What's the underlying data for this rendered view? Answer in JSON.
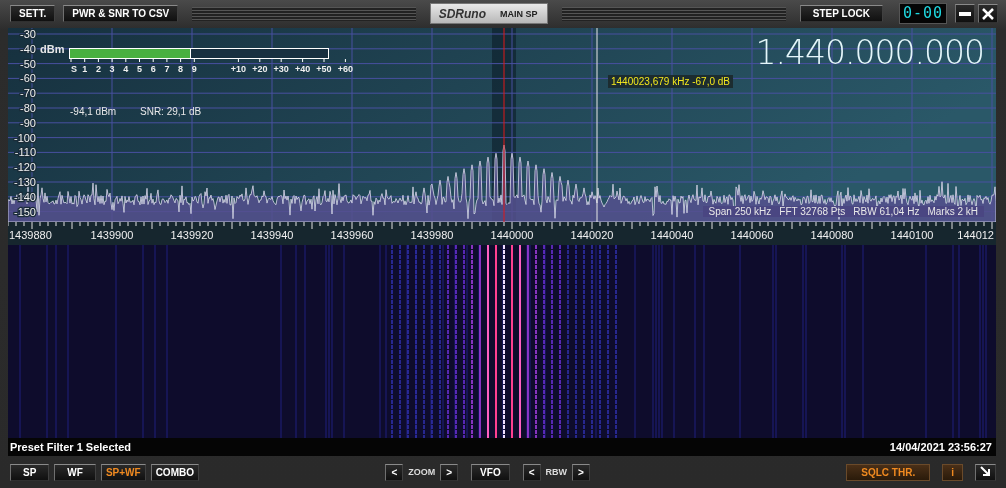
{
  "toolbar": {
    "left_buttons": [
      "SETT.",
      "PWR & SNR TO CSV"
    ],
    "title": "SDRuno",
    "subtitle": "MAIN SP",
    "step_lock": "STEP LOCK",
    "counter": "0-00"
  },
  "spectrum": {
    "unit": "dBm",
    "y_labels": [
      "-30",
      "-40",
      "-50",
      "-60",
      "-70",
      "-80",
      "-90",
      "-100",
      "-110",
      "-120",
      "-130",
      "-140",
      "-150"
    ],
    "s_meter": {
      "level": 0.47,
      "scale": [
        "S",
        "1",
        "2",
        "3",
        "4",
        "5",
        "6",
        "7",
        "8",
        "9",
        "+10",
        "+20",
        "+30",
        "+40",
        "+50",
        "+60"
      ]
    },
    "power": "-94,1 dBm",
    "snr": "SNR: 29,1 dB",
    "frequency": "1.440.000.000",
    "cursor_readout": "1440023,679 kHz -67,0 dB",
    "info": [
      "Span 250 kHz",
      "FFT 32768 Pts",
      "RBW 61,04 Hz",
      "Marks 2 kH"
    ],
    "x_labels": [
      "1439880",
      "1439900",
      "1439920",
      "1439940",
      "1439960",
      "1439980",
      "1440000",
      "1440020",
      "1440040",
      "1440060",
      "1440080",
      "1440100",
      "144012"
    ]
  },
  "status": {
    "message": "Preset Filter 1 Selected",
    "datetime": "14/04/2021 23:56:27"
  },
  "view_tabs": [
    {
      "label": "SP",
      "selected": false
    },
    {
      "label": "WF",
      "selected": false
    },
    {
      "label": "SP+WF",
      "selected": true
    },
    {
      "label": "COMBO",
      "selected": false
    }
  ],
  "controls": [
    {
      "kind": "button",
      "label": "<"
    },
    {
      "kind": "label",
      "label": "ZOOM"
    },
    {
      "kind": "button",
      "label": ">"
    },
    {
      "kind": "button",
      "label": "VFO"
    },
    {
      "kind": "button",
      "label": "<"
    },
    {
      "kind": "label",
      "label": "RBW"
    },
    {
      "kind": "button",
      "label": ">"
    }
  ],
  "right_buttons": [
    "SQLC THR.",
    "i"
  ]
}
